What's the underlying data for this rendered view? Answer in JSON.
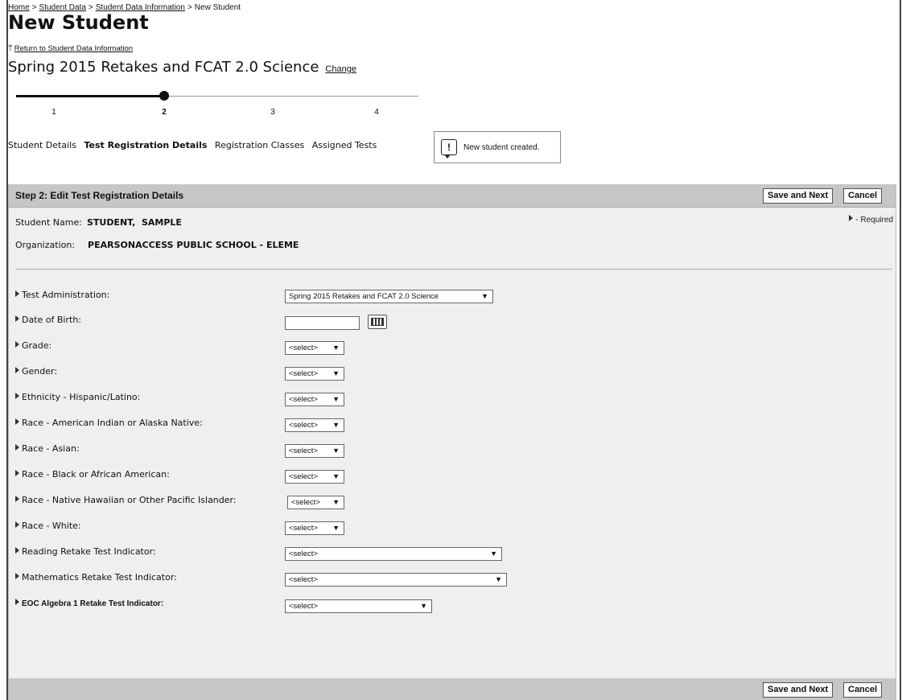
{
  "breadcrumb": {
    "home": "Home",
    "student_data": "Student Data",
    "student_data_information": "Student Data Information",
    "current": "New Student",
    "separator": ">"
  },
  "page_title": "New Student",
  "return_link": "Return to Student Data Information",
  "administration": {
    "name": "Spring 2015 Retakes and FCAT 2.0 Science",
    "change_label": "Change"
  },
  "progress": {
    "steps": [
      "1",
      "2",
      "3",
      "4"
    ],
    "current_step": 2,
    "labels": [
      "Student Details",
      "Test Registration Details",
      "Registration Classes",
      "Assigned Tests"
    ]
  },
  "notice": {
    "text": "New student created.",
    "icon": "alert-speech-bubble-icon"
  },
  "panel": {
    "title": "Step 2: Edit Test Registration Details",
    "save_label": "Save and Next",
    "cancel_label": "Cancel",
    "required_note": "- Required",
    "student_name_label": "Student Name:",
    "student_name_value": "STUDENT,  SAMPLE",
    "organization_label": "Organization:",
    "organization_value": "PEARSONACCESS PUBLIC SCHOOL - ELEME"
  },
  "fields": {
    "test_administration": {
      "label": "Test Administration:",
      "value": "Spring 2015 Retakes and FCAT 2.0 Science"
    },
    "date_of_birth": {
      "label": "Date of Birth:",
      "value": ""
    },
    "grade": {
      "label": "Grade:",
      "value": "<select>"
    },
    "gender": {
      "label": "Gender:",
      "value": "<select>"
    },
    "ethnicity": {
      "label": "Ethnicity - Hispanic/Latino:",
      "value": "<select>"
    },
    "race_american_indian": {
      "label": "Race - American Indian or Alaska Native:",
      "value": "<select>"
    },
    "race_asian": {
      "label": "Race - Asian:",
      "value": "<select>"
    },
    "race_black": {
      "label": "Race - Black or African American:",
      "value": "<select>"
    },
    "race_hawaiian": {
      "label": "Race - Native Hawaiian or Other Pacific Islander:",
      "value": "<select>"
    },
    "race_white": {
      "label": "Race - White:",
      "value": "<select>"
    },
    "reading_retake": {
      "label": "Reading Retake Test Indicator:",
      "value": "<select>"
    },
    "math_retake": {
      "label": "Mathematics Retake Test Indicator:",
      "value": "<select>"
    },
    "eoc_algebra_retake": {
      "label": "EOC Algebra 1 Retake Test Indicator:",
      "value": "<select>"
    }
  }
}
